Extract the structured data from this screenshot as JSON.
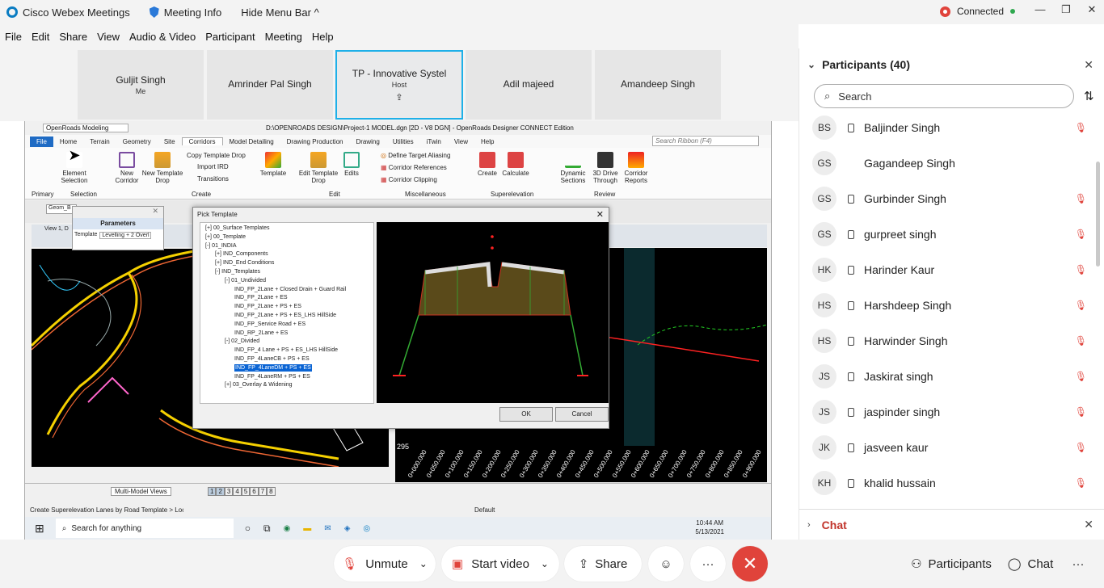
{
  "titlebar": {
    "app": "Cisco Webex Meetings",
    "meeting_info": "Meeting Info",
    "hide_menu": "Hide Menu Bar ^",
    "connection": "Connected"
  },
  "menu": [
    "File",
    "Edit",
    "Share",
    "View",
    "Audio & Video",
    "Participant",
    "Meeting",
    "Help"
  ],
  "video_tiles": [
    {
      "name": "Guljit Singh",
      "sub": "Me"
    },
    {
      "name": "Amrinder Pal Singh",
      "sub": ""
    },
    {
      "name": "TP - Innovative Systel",
      "sub": "Host"
    },
    {
      "name": "Adil majeed",
      "sub": ""
    },
    {
      "name": "Amandeep Singh",
      "sub": ""
    }
  ],
  "openroads": {
    "workflow": "OpenRoads Modeling",
    "title": "D:\\OPENROADS DESIGN\\Project-1 MODEL.dgn [2D - V8 DGN] - OpenRoads Designer CONNECT Edition",
    "tabs": [
      "File",
      "Home",
      "Terrain",
      "Geometry",
      "Site",
      "Corridors",
      "Model Detailing",
      "Drawing Production",
      "Drawing",
      "Utilities",
      "iTwin",
      "View",
      "Help"
    ],
    "search_ribbon": "Search Ribbon (F4)",
    "groups": [
      "Primary",
      "Selection",
      "Create",
      "Edit",
      "Miscellaneous",
      "Superelevation",
      "Review"
    ],
    "buttons": {
      "element_selection": "Element Selection",
      "new_corridor": "New Corridor",
      "new_template_drop": "New Template Drop",
      "copy_template_drop": "Copy Template Drop",
      "import_ird": "Import IRD",
      "transitions": "Transitions",
      "template": "Template",
      "edit_template_drop": "Edit Template Drop",
      "edits": "Edits",
      "define_target_aliasing": "Define Target Aliasing",
      "corridor_references": "Corridor References",
      "corridor_clipping": "Corridor Clipping",
      "create": "Create",
      "calculate": "Calculate",
      "dynamic_sections": "Dynamic Sections",
      "drive_through": "3D Drive Through",
      "corridor_reports": "Corridor Reports"
    },
    "view_label": "View 1, D",
    "geom_field": "Geom_B",
    "params_title": "Parameters",
    "params_label": "Template",
    "params_value": "Levelling + 2 Overl",
    "status_text": "Create Superelevation Lanes by Road Template > Loc",
    "status_level": "Default",
    "multi_model": "Multi-Model Views",
    "view_numbers": [
      "1",
      "2",
      "3",
      "4",
      "5",
      "6",
      "7",
      "8"
    ],
    "profile_y": "295",
    "profile_stations": [
      "0+000.000",
      "0+050.000",
      "0+100.000",
      "0+150.000",
      "0+200.000",
      "0+250.000",
      "0+300.000",
      "0+350.000",
      "0+400.000",
      "0+450.000",
      "0+500.000",
      "0+550.000",
      "0+600.000",
      "0+650.000",
      "0+700.000",
      "0+750.000",
      "0+800.000",
      "0+850.000",
      "0+900.000"
    ]
  },
  "dialog": {
    "title": "Pick Template",
    "tree": [
      {
        "label": "00_Surface Templates",
        "level": 1,
        "box": "+"
      },
      {
        "label": "00_Template",
        "level": 1,
        "box": "+"
      },
      {
        "label": "01_INDIA",
        "level": 1,
        "box": "-"
      },
      {
        "label": "IND_Components",
        "level": 2,
        "box": "+"
      },
      {
        "label": "IND_End Conditions",
        "level": 2,
        "box": "+"
      },
      {
        "label": "IND_Templates",
        "level": 2,
        "box": "-"
      },
      {
        "label": "01_Undivided",
        "level": 3,
        "box": "-"
      },
      {
        "label": "IND_FP_2Lane + Closed Drain + Guard Rail",
        "level": 4,
        "box": ""
      },
      {
        "label": "IND_FP_2Lane + ES",
        "level": 4,
        "box": ""
      },
      {
        "label": "IND_FP_2Lane + PS + ES",
        "level": 4,
        "box": ""
      },
      {
        "label": "IND_FP_2Lane + PS + ES_LHS HillSide",
        "level": 4,
        "box": ""
      },
      {
        "label": "IND_FP_Service Road + ES",
        "level": 4,
        "box": ""
      },
      {
        "label": "IND_RP_2Lane + ES",
        "level": 4,
        "box": ""
      },
      {
        "label": "02_Divided",
        "level": 3,
        "box": "-"
      },
      {
        "label": "IND_FP_4 Lane + PS + ES_LHS HillSide",
        "level": 4,
        "box": ""
      },
      {
        "label": "IND_FP_4LaneCB + PS + ES",
        "level": 4,
        "box": ""
      },
      {
        "label": "IND_FP_4LaneDM + PS + ES",
        "level": 4,
        "box": "",
        "selected": true
      },
      {
        "label": "IND_FP_4LaneRM + PS + ES",
        "level": 4,
        "box": ""
      },
      {
        "label": "03_Overlay & Widening",
        "level": 3,
        "box": "+"
      }
    ],
    "ok": "OK",
    "cancel": "Cancel"
  },
  "taskbar": {
    "search": "Search for anything",
    "time": "10:44 AM",
    "date": "5/13/2021"
  },
  "participants": {
    "title": "Participants (40)",
    "search_placeholder": "Search",
    "list": [
      {
        "initials": "BS",
        "name": "Baljinder Singh",
        "phone": true,
        "muted": true
      },
      {
        "initials": "GS",
        "name": "Gagandeep Singh",
        "phone": false,
        "muted": false
      },
      {
        "initials": "GS",
        "name": "Gurbinder Singh",
        "phone": true,
        "muted": true
      },
      {
        "initials": "GS",
        "name": "gurpreet singh",
        "phone": true,
        "muted": true
      },
      {
        "initials": "HK",
        "name": "Harinder Kaur",
        "phone": true,
        "muted": true
      },
      {
        "initials": "HS",
        "name": "Harshdeep Singh",
        "phone": true,
        "muted": true
      },
      {
        "initials": "HS",
        "name": "Harwinder Singh",
        "phone": true,
        "muted": true
      },
      {
        "initials": "JS",
        "name": "Jaskirat singh",
        "phone": true,
        "muted": true
      },
      {
        "initials": "JS",
        "name": "jaspinder singh",
        "phone": true,
        "muted": true
      },
      {
        "initials": "JK",
        "name": "jasveen kaur",
        "phone": true,
        "muted": true
      },
      {
        "initials": "KH",
        "name": "khalid hussain",
        "phone": true,
        "muted": true
      }
    ]
  },
  "chat": {
    "title": "Chat"
  },
  "controls": {
    "unmute": "Unmute",
    "start_video": "Start video",
    "share": "Share",
    "participants": "Participants",
    "chat": "Chat"
  },
  "colors": {
    "accent": "#1eb0e8",
    "danger": "#e0433b",
    "connected": "#2fa84f",
    "selected": "#0a64d4"
  }
}
